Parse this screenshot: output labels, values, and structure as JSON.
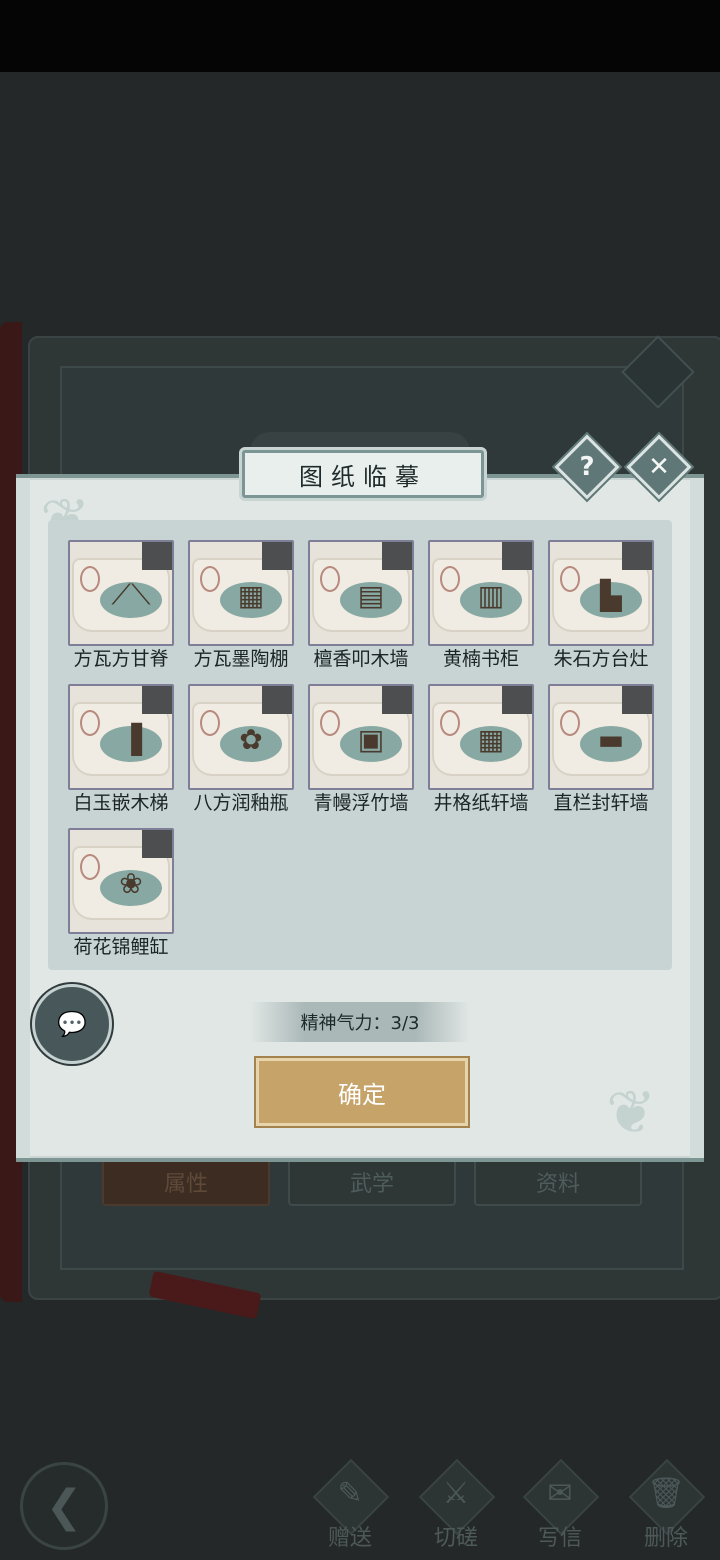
{
  "background_tabs": [
    "属性",
    "武学",
    "资料"
  ],
  "bottom_nav": [
    {
      "label": "赠送",
      "icon": "scroll-icon"
    },
    {
      "label": "切磋",
      "icon": "sword-icon"
    },
    {
      "label": "写信",
      "icon": "letter-icon"
    },
    {
      "label": "删除",
      "icon": "trash-icon"
    }
  ],
  "dialog": {
    "title": "图纸临摹",
    "items": [
      {
        "name": "方瓦方甘脊",
        "glyph": "⟋⟍"
      },
      {
        "name": "方瓦墨陶棚",
        "glyph": "▦"
      },
      {
        "name": "檀香叩木墙",
        "glyph": "▤"
      },
      {
        "name": "黄楠书柜",
        "glyph": "▥"
      },
      {
        "name": "朱石方台灶",
        "glyph": "▙"
      },
      {
        "name": "白玉嵌木梯",
        "glyph": "▐"
      },
      {
        "name": "八方润釉瓶",
        "glyph": "✿"
      },
      {
        "name": "青幔浮竹墙",
        "glyph": "▣"
      },
      {
        "name": "井格纸轩墙",
        "glyph": "▦"
      },
      {
        "name": "直栏封轩墙",
        "glyph": "▬"
      },
      {
        "name": "荷花锦鲤缸",
        "glyph": "❀"
      }
    ],
    "energy_label": "精神气力：3/3",
    "confirm_label": "确定"
  },
  "colors": {
    "dialog_bg": "#e1e7e5",
    "panel_bg": "#c7d4d3",
    "accent_teal": "#5f7877",
    "confirm_gold": "#c6a369"
  }
}
